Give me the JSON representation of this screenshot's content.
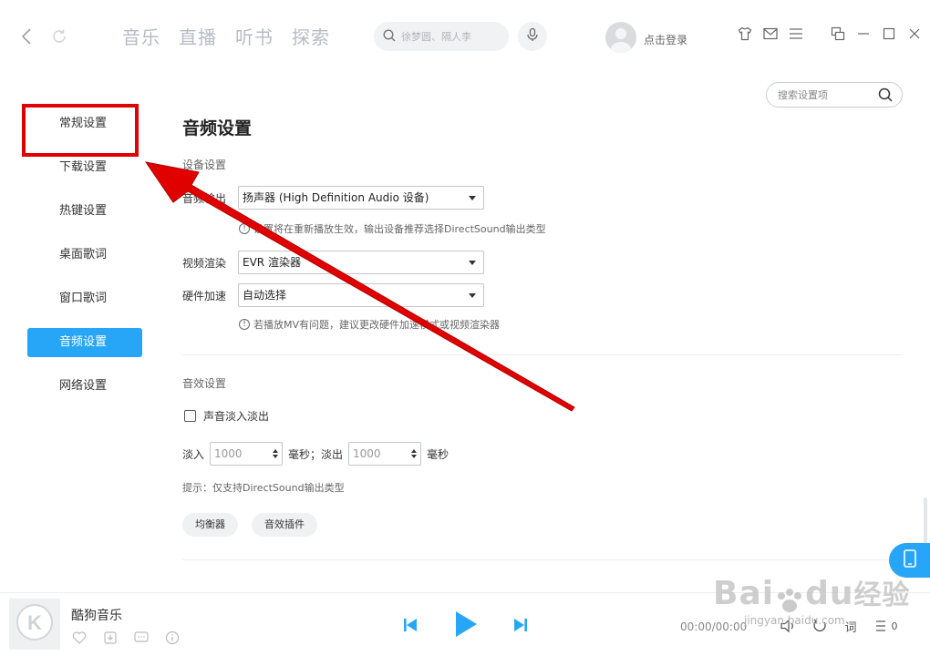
{
  "top_nav": {
    "tabs": [
      "音乐",
      "直播",
      "听书",
      "探索"
    ],
    "search_placeholder": "徐梦圆、隔人李",
    "login_text": "点击登录"
  },
  "sidebar": {
    "items": [
      {
        "label": "常规设置",
        "active": false
      },
      {
        "label": "下载设置",
        "active": false
      },
      {
        "label": "热键设置",
        "active": false
      },
      {
        "label": "桌面歌词",
        "active": false
      },
      {
        "label": "窗口歌词",
        "active": false
      },
      {
        "label": "音频设置",
        "active": true
      },
      {
        "label": "网络设置",
        "active": false
      }
    ]
  },
  "settings_search_placeholder": "搜索设置项",
  "audio": {
    "title": "音频设置",
    "device_section": "设备设置",
    "output_label": "音频输出",
    "output_value": "扬声器 (High Definition Audio 设备)",
    "output_note": "设置将在重新播放生效，输出设备推荐选择DirectSound输出类型",
    "video_render_label": "视频渲染",
    "video_render_value": "EVR 渲染器",
    "hw_accel_label": "硬件加速",
    "hw_accel_value": "自动选择",
    "hw_note": "若播放MV有问题，建议更改硬件加速模式或视频渲染器",
    "effect_section": "音效设置",
    "fade_checkbox": "声音淡入淡出",
    "fade_in_label": "淡入",
    "fade_in_value": "1000",
    "ms_fade_out_label": "毫秒；淡出",
    "fade_out_value": "1000",
    "ms_label": "毫秒",
    "hint": "提示：仅支持DirectSound输出类型",
    "equalizer_btn": "均衡器",
    "plugin_btn": "音效插件"
  },
  "player": {
    "song_name": "酷狗音乐",
    "time": "00:00/00:00",
    "lyrics_label": "词",
    "playlist_count": "0"
  },
  "watermark": {
    "main": "Bai",
    "main2": "du",
    "cn": "经验",
    "sub": "jingyan.baidu.com"
  },
  "colors": {
    "accent": "#27a5f7",
    "annotation_red": "#e00000"
  }
}
